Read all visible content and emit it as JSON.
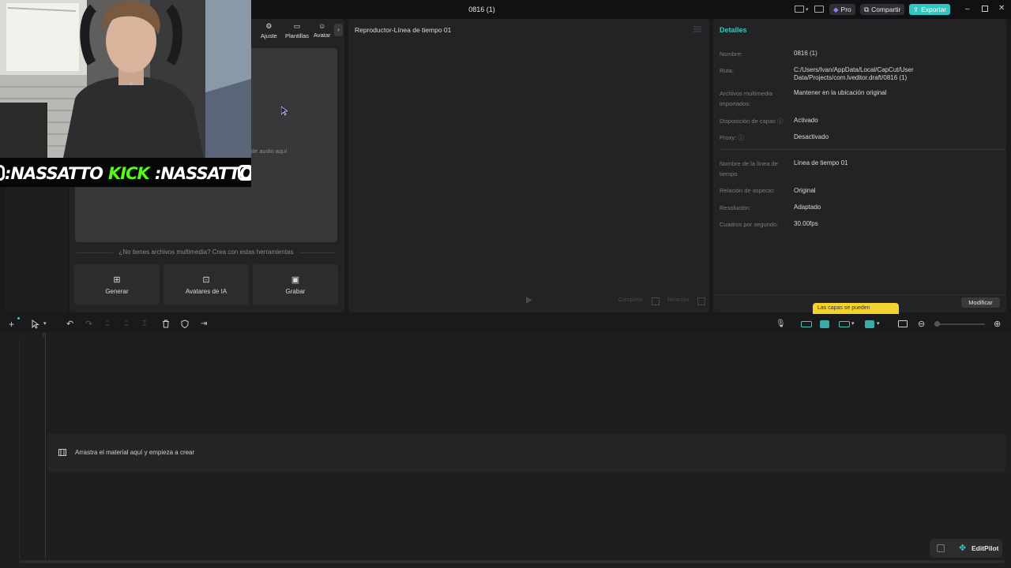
{
  "titlebar": {
    "title": "0816 (1)",
    "pro_label": "Pro",
    "share_label": "Compartir",
    "export_label": "Exportar"
  },
  "media": {
    "tabs": [
      "Ajuste",
      "Plantillas",
      "Avatar"
    ],
    "drop_text": "s de audio aquí",
    "no_media_text": "¿No tienes archivos multimedia? Crea con estas herramientas",
    "tools": [
      "Generar",
      "Avatares de IA",
      "Grabar"
    ]
  },
  "player": {
    "title": "Reproductor-Línea de tiempo 01",
    "controls": [
      "Completa",
      "Relación"
    ]
  },
  "details": {
    "title": "Detalles",
    "rows": [
      {
        "label": "Nombre:",
        "value": "0816 (1)"
      },
      {
        "label": "Ruta:",
        "value": "C:/Users/Ivan/AppData/Local/CapCut/User Data/Projects/com.lveditor.draft/0816 (1)"
      },
      {
        "label": "Archivos multimedia importados:",
        "value": "Mantener en la ubicación original"
      },
      {
        "label": "Disposición de capas ⓘ",
        "value": "Activado"
      },
      {
        "label": "Proxy: ⓘ",
        "value": "Desactivado"
      },
      {
        "label": "Nombre de la línea de tiempo",
        "value": "Línea de tiempo 01"
      },
      {
        "label": "Relación de aspecto:",
        "value": "Original"
      },
      {
        "label": "Resolución:",
        "value": "Adaptado"
      },
      {
        "label": "Cuadros por segundo:",
        "value": "30.00fps"
      }
    ],
    "modify_label": "Modificar",
    "tooltip": "Las capas se pueden"
  },
  "timeline": {
    "playhead_label": "0",
    "main_track_text": "Arrastra el material aquí y empieza a crear",
    "editpilot_label": "EditPilot"
  },
  "overlay": {
    "banner_left": ":NASSATTO",
    "banner_kick": "KICK",
    "banner_right": ":NASSATTO",
    "accent_green": "#53fc18"
  },
  "colors": {
    "accent": "#3ec5c0",
    "export": "#2ec7c2",
    "tooltip": "#f4d331"
  }
}
